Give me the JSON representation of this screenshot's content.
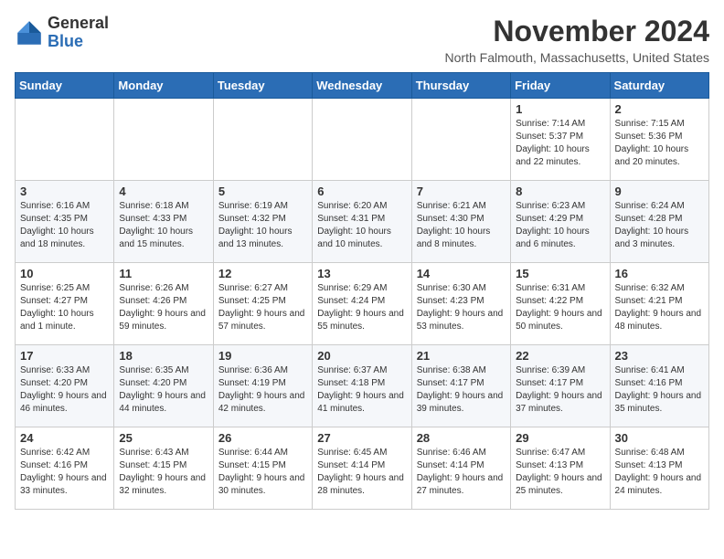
{
  "logo": {
    "general": "General",
    "blue": "Blue"
  },
  "header": {
    "month_title": "November 2024",
    "location": "North Falmouth, Massachusetts, United States"
  },
  "days_of_week": [
    "Sunday",
    "Monday",
    "Tuesday",
    "Wednesday",
    "Thursday",
    "Friday",
    "Saturday"
  ],
  "weeks": [
    [
      {
        "day": "",
        "info": ""
      },
      {
        "day": "",
        "info": ""
      },
      {
        "day": "",
        "info": ""
      },
      {
        "day": "",
        "info": ""
      },
      {
        "day": "",
        "info": ""
      },
      {
        "day": "1",
        "info": "Sunrise: 7:14 AM\nSunset: 5:37 PM\nDaylight: 10 hours and 22 minutes."
      },
      {
        "day": "2",
        "info": "Sunrise: 7:15 AM\nSunset: 5:36 PM\nDaylight: 10 hours and 20 minutes."
      }
    ],
    [
      {
        "day": "3",
        "info": "Sunrise: 6:16 AM\nSunset: 4:35 PM\nDaylight: 10 hours and 18 minutes."
      },
      {
        "day": "4",
        "info": "Sunrise: 6:18 AM\nSunset: 4:33 PM\nDaylight: 10 hours and 15 minutes."
      },
      {
        "day": "5",
        "info": "Sunrise: 6:19 AM\nSunset: 4:32 PM\nDaylight: 10 hours and 13 minutes."
      },
      {
        "day": "6",
        "info": "Sunrise: 6:20 AM\nSunset: 4:31 PM\nDaylight: 10 hours and 10 minutes."
      },
      {
        "day": "7",
        "info": "Sunrise: 6:21 AM\nSunset: 4:30 PM\nDaylight: 10 hours and 8 minutes."
      },
      {
        "day": "8",
        "info": "Sunrise: 6:23 AM\nSunset: 4:29 PM\nDaylight: 10 hours and 6 minutes."
      },
      {
        "day": "9",
        "info": "Sunrise: 6:24 AM\nSunset: 4:28 PM\nDaylight: 10 hours and 3 minutes."
      }
    ],
    [
      {
        "day": "10",
        "info": "Sunrise: 6:25 AM\nSunset: 4:27 PM\nDaylight: 10 hours and 1 minute."
      },
      {
        "day": "11",
        "info": "Sunrise: 6:26 AM\nSunset: 4:26 PM\nDaylight: 9 hours and 59 minutes."
      },
      {
        "day": "12",
        "info": "Sunrise: 6:27 AM\nSunset: 4:25 PM\nDaylight: 9 hours and 57 minutes."
      },
      {
        "day": "13",
        "info": "Sunrise: 6:29 AM\nSunset: 4:24 PM\nDaylight: 9 hours and 55 minutes."
      },
      {
        "day": "14",
        "info": "Sunrise: 6:30 AM\nSunset: 4:23 PM\nDaylight: 9 hours and 53 minutes."
      },
      {
        "day": "15",
        "info": "Sunrise: 6:31 AM\nSunset: 4:22 PM\nDaylight: 9 hours and 50 minutes."
      },
      {
        "day": "16",
        "info": "Sunrise: 6:32 AM\nSunset: 4:21 PM\nDaylight: 9 hours and 48 minutes."
      }
    ],
    [
      {
        "day": "17",
        "info": "Sunrise: 6:33 AM\nSunset: 4:20 PM\nDaylight: 9 hours and 46 minutes."
      },
      {
        "day": "18",
        "info": "Sunrise: 6:35 AM\nSunset: 4:20 PM\nDaylight: 9 hours and 44 minutes."
      },
      {
        "day": "19",
        "info": "Sunrise: 6:36 AM\nSunset: 4:19 PM\nDaylight: 9 hours and 42 minutes."
      },
      {
        "day": "20",
        "info": "Sunrise: 6:37 AM\nSunset: 4:18 PM\nDaylight: 9 hours and 41 minutes."
      },
      {
        "day": "21",
        "info": "Sunrise: 6:38 AM\nSunset: 4:17 PM\nDaylight: 9 hours and 39 minutes."
      },
      {
        "day": "22",
        "info": "Sunrise: 6:39 AM\nSunset: 4:17 PM\nDaylight: 9 hours and 37 minutes."
      },
      {
        "day": "23",
        "info": "Sunrise: 6:41 AM\nSunset: 4:16 PM\nDaylight: 9 hours and 35 minutes."
      }
    ],
    [
      {
        "day": "24",
        "info": "Sunrise: 6:42 AM\nSunset: 4:16 PM\nDaylight: 9 hours and 33 minutes."
      },
      {
        "day": "25",
        "info": "Sunrise: 6:43 AM\nSunset: 4:15 PM\nDaylight: 9 hours and 32 minutes."
      },
      {
        "day": "26",
        "info": "Sunrise: 6:44 AM\nSunset: 4:15 PM\nDaylight: 9 hours and 30 minutes."
      },
      {
        "day": "27",
        "info": "Sunrise: 6:45 AM\nSunset: 4:14 PM\nDaylight: 9 hours and 28 minutes."
      },
      {
        "day": "28",
        "info": "Sunrise: 6:46 AM\nSunset: 4:14 PM\nDaylight: 9 hours and 27 minutes."
      },
      {
        "day": "29",
        "info": "Sunrise: 6:47 AM\nSunset: 4:13 PM\nDaylight: 9 hours and 25 minutes."
      },
      {
        "day": "30",
        "info": "Sunrise: 6:48 AM\nSunset: 4:13 PM\nDaylight: 9 hours and 24 minutes."
      }
    ]
  ]
}
